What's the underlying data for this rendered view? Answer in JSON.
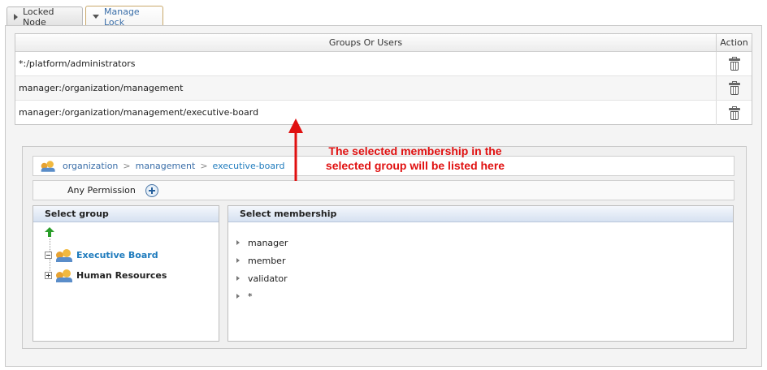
{
  "tabs": [
    {
      "label": "Locked Node"
    },
    {
      "label": "Manage Lock"
    }
  ],
  "groups_table": {
    "headers": {
      "groups": "Groups Or Users",
      "action": "Action"
    },
    "rows": [
      {
        "value": "*:/platform/administrators"
      },
      {
        "value": "manager:/organization/management"
      },
      {
        "value": "manager:/organization/management/executive-board"
      }
    ]
  },
  "annotation": {
    "line1": "The selected membership in the",
    "line2": "selected group will be listed here",
    "color": "#e01010"
  },
  "breadcrumb": {
    "items": [
      "organization",
      "management",
      "executive-board"
    ],
    "separator": ">"
  },
  "permission": {
    "label": "Any Permission"
  },
  "select_group": {
    "title": "Select group",
    "nodes": [
      {
        "label": "Executive Board"
      },
      {
        "label": "Human Resources"
      }
    ]
  },
  "select_membership": {
    "title": "Select membership",
    "items": [
      "manager",
      "member",
      "validator",
      "*"
    ]
  }
}
